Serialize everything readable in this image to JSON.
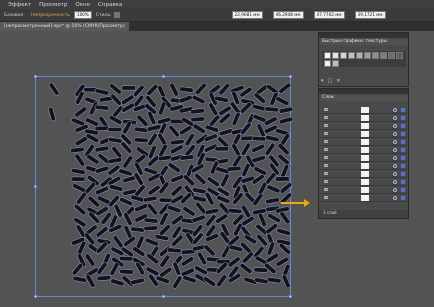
{
  "menubar": {
    "items": [
      "Эффект",
      "Просмотр",
      "Окно",
      "Справка"
    ]
  },
  "controlbar": {
    "stroke_style": "Базовая",
    "opacity_label": "Непрозрачность",
    "opacity_value": "100%",
    "style_label": "Стиль:",
    "x_value": "22,9681 мм",
    "y_value": "46,2948 мм",
    "w_value": "47,7702 мм",
    "h_value": "39,1721 мм"
  },
  "document_tab": {
    "title": "[непросмотренный].eps* @ 50% (CMYK/Просмотр)"
  },
  "swatches_panel": {
    "title": "Быстрые графики: текстуры",
    "colors": [
      "#f5f5f5",
      "#e4e4e4",
      "#d3d3d3",
      "#c2c2c2",
      "#b1b1b1",
      "#a0a0a0",
      "#8f8f8f",
      "#7e7e7e",
      "#6d6d6d",
      "#5c5c5c",
      "#f0f0f0",
      "#bcbcbc"
    ]
  },
  "layers_panel": {
    "title": "Слои",
    "rows": 12,
    "footer": "1 слой"
  },
  "colors": {
    "selection": "#6e84d6",
    "arrow": "#f4a900",
    "shape_fill": "#141414",
    "shape_stroke": "#8fa2ea"
  }
}
